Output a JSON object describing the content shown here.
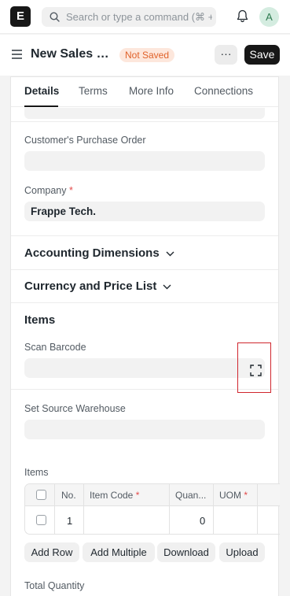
{
  "navbar": {
    "logo_letter": "E",
    "search_placeholder": "Search or type a command (⌘ + G)",
    "avatar_initial": "A"
  },
  "header": {
    "title": "New Sales Order",
    "status": "Not Saved",
    "more_label": "···",
    "save_label": "Save"
  },
  "tabs": [
    "Details",
    "Terms",
    "More Info",
    "Connections"
  ],
  "fields": {
    "customer_po_label": "Customer's Purchase Order",
    "customer_po_value": "",
    "company_label": "Company",
    "required_mark": "*",
    "company_value": "Frappe Tech."
  },
  "sections": {
    "accounting": "Accounting Dimensions",
    "currency": "Currency and Price List",
    "items": "Items"
  },
  "items_section": {
    "scan_barcode_label": "Scan Barcode",
    "scan_barcode_value": "",
    "source_warehouse_label": "Set Source Warehouse",
    "source_warehouse_value": "",
    "items_label": "Items"
  },
  "items_table": {
    "headers": {
      "no": "No.",
      "item_code": "Item Code",
      "quantity": "Quan...",
      "uom": "UOM",
      "required_mark": "*"
    },
    "rows": [
      {
        "no": "1",
        "item_code": "",
        "quantity": "0",
        "uom": ""
      }
    ]
  },
  "table_buttons": {
    "add_row": "Add Row",
    "add_multiple": "Add Multiple",
    "download": "Download",
    "upload": "Upload"
  },
  "footer_label": "Total Quantity"
}
